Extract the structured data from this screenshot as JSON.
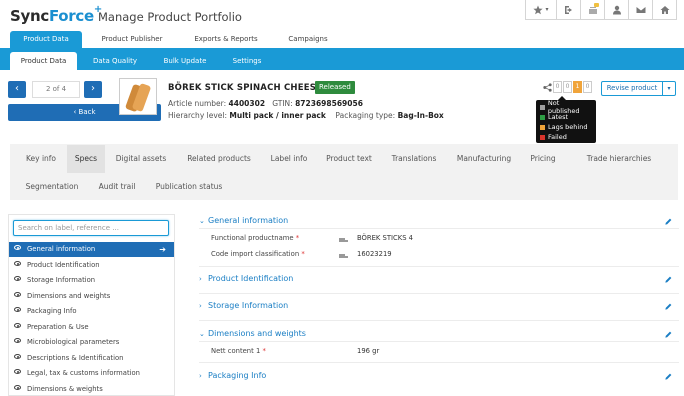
{
  "app": {
    "logo_sync": "Sync",
    "logo_force": "Force",
    "logo_plus": "+",
    "title": "Manage Product Portfolio"
  },
  "header_icons": [
    "star-dropdown-icon",
    "sign-out-icon",
    "notification-box-icon",
    "user-icon",
    "envelope-icon",
    "home-icon"
  ],
  "main_tabs": [
    "Product Data",
    "Product Publisher",
    "Exports & Reports",
    "Campaigns"
  ],
  "sub_tabs": [
    "Product Data",
    "Data Quality",
    "Bulk Update",
    "Settings"
  ],
  "pager": {
    "text": "2 of 4",
    "back_label": "Back"
  },
  "product": {
    "name": "BÖREK STICK SPINACH CHEESE",
    "status": "Released",
    "article_label": "Article number:",
    "article_number": "4400302",
    "gtin_label": "GTIN:",
    "gtin": "8723698569056",
    "hierarchy_label": "Hierarchy level:",
    "hierarchy": "Multi pack / inner pack",
    "packaging_label": "Packaging type:",
    "packaging": "Bag-In-Box"
  },
  "publish_counts": [
    "0",
    "0",
    "1",
    "0"
  ],
  "revise_label": "Revise product",
  "legend": [
    {
      "label": "Not published",
      "color": "#9e9e9e"
    },
    {
      "label": "Latest",
      "color": "#2e9e44"
    },
    {
      "label": "Lags behind",
      "color": "#f0a43a"
    },
    {
      "label": "Failed",
      "color": "#d9342b"
    }
  ],
  "section_tabs_row1": [
    "Key info",
    "Specs",
    "Digital assets",
    "Related products",
    "Label info",
    "Product text",
    "Translations",
    "Manufacturing",
    "Pricing",
    "Trade hierarchies"
  ],
  "section_tabs_row2": [
    "Segmentation",
    "Audit trail",
    "Publication status"
  ],
  "search_placeholder": "Search on label, reference ...",
  "nav_items": [
    "General information",
    "Product Identification",
    "Storage Information",
    "Dimensions and weights",
    "Packaging Info",
    "Preparation & Use",
    "Microbiological parameters",
    "Descriptions & Identification",
    "Legal, tax & customs information",
    "Dimensions & weights"
  ],
  "sections": {
    "general": {
      "title": "General information",
      "fields": [
        {
          "label": "Functional productname",
          "value": "BÖREK STICKS 4"
        },
        {
          "label": "Code import classification",
          "value": "16023219"
        }
      ]
    },
    "identification": {
      "title": "Product Identification"
    },
    "storage": {
      "title": "Storage Information"
    },
    "dimensions": {
      "title": "Dimensions and weights",
      "fields": [
        {
          "label": "Nett content 1",
          "value": "196 gr"
        }
      ]
    },
    "packaging": {
      "title": "Packaging Info"
    }
  }
}
